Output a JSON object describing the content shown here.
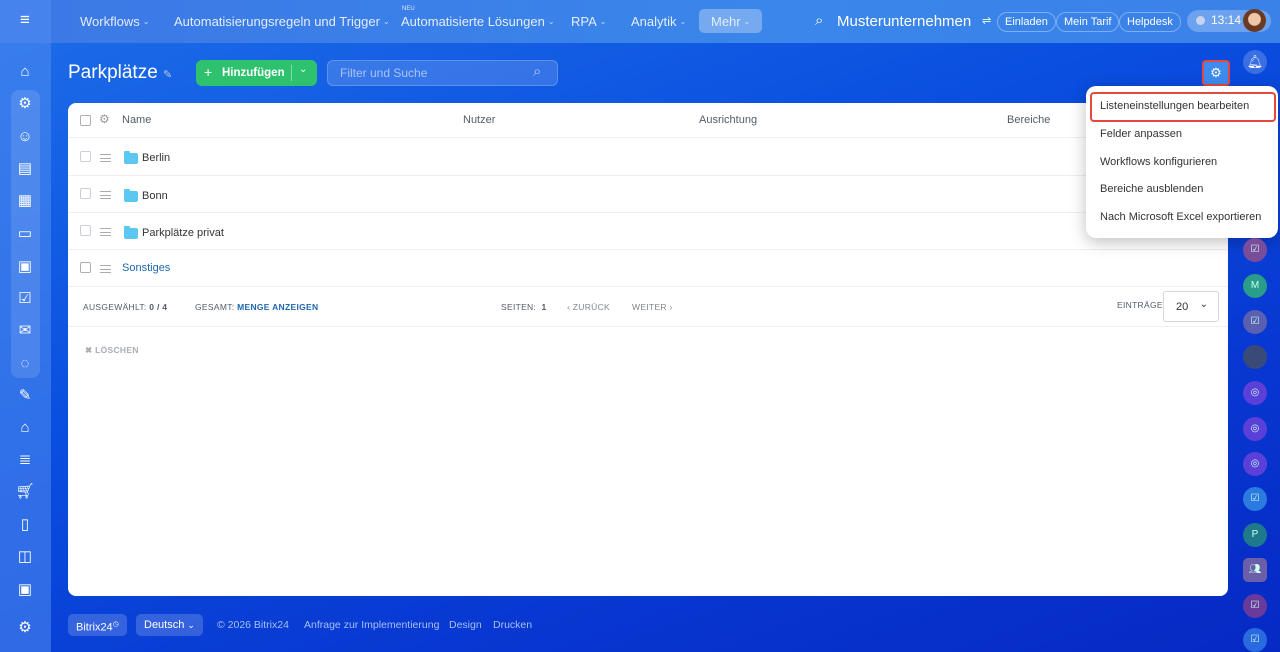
{
  "topbar": {
    "nav": [
      {
        "label": "Workflows"
      },
      {
        "label": "Automatisierungsregeln und Trigger"
      },
      {
        "label": "Automatisierte Lösungen",
        "badge": "NEU"
      },
      {
        "label": "RPA"
      },
      {
        "label": "Analytik"
      },
      {
        "label": "Mehr"
      }
    ],
    "company": "Musterunternehmen",
    "invite": "Einladen",
    "tariff": "Mein Tarif",
    "helpdesk": "Helpdesk",
    "time": "13:14"
  },
  "page": {
    "title": "Parkplätze",
    "add_label": "Hinzufügen",
    "search_placeholder": "Filter und Suche"
  },
  "table": {
    "columns": [
      "Name",
      "Nutzer",
      "Ausrichtung",
      "Bereiche"
    ],
    "rows": [
      {
        "name": "Berlin",
        "type": "folder"
      },
      {
        "name": "Bonn",
        "type": "folder"
      },
      {
        "name": "Parkplätze privat",
        "type": "folder"
      },
      {
        "name": "Sonstiges",
        "type": "item"
      }
    ],
    "selected_label": "AUSGEWÄHLT:",
    "selected_value": "0 / 4",
    "total_label": "GESAMT:",
    "total_link": "MENGE ANZEIGEN",
    "pages_label": "SEITEN:",
    "page": "1",
    "prev": "ZURÜCK",
    "next": "WEITER",
    "entries_label": "EINTRÄGE",
    "entries_value": "20",
    "delete": "LÖSCHEN"
  },
  "menu": [
    "Listeneinstellungen bearbeiten",
    "Felder anpassen",
    "Workflows konfigurieren",
    "Bereiche ausblenden",
    "Nach Microsoft Excel exportieren"
  ],
  "right_avatars": [
    "M",
    "P"
  ],
  "footer": {
    "brand": "Bitrix24",
    "language": "Deutsch",
    "copyright": "© 2026 Bitrix24",
    "links": [
      "Anfrage zur Implementierung",
      "Design",
      "Drucken"
    ]
  },
  "colors": {
    "accent": "#2fc26e",
    "highlight": "#e5483f",
    "link": "#2067b0"
  }
}
